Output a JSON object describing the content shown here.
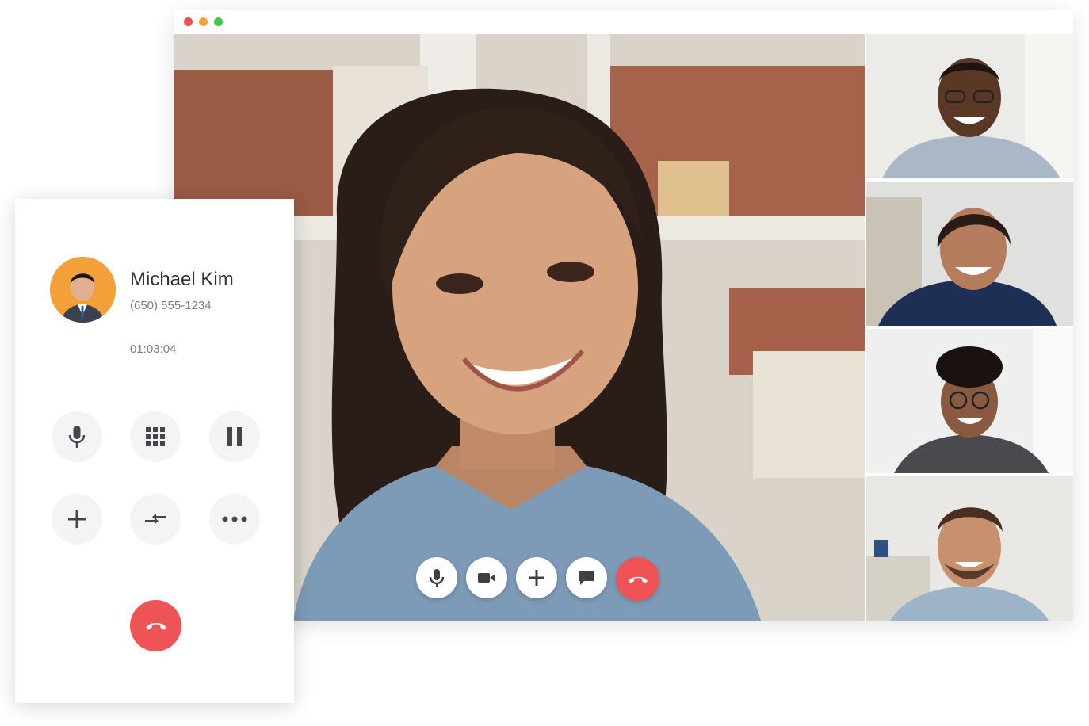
{
  "contact": {
    "name": "Michael Kim",
    "phone": "(650) 555-1234",
    "duration": "01:03:04"
  },
  "phone_controls": [
    {
      "id": "mute",
      "icon": "microphone-icon"
    },
    {
      "id": "keypad",
      "icon": "keypad-icon"
    },
    {
      "id": "hold",
      "icon": "pause-icon"
    },
    {
      "id": "add-call",
      "icon": "plus-icon"
    },
    {
      "id": "merge",
      "icon": "merge-arrows-icon"
    },
    {
      "id": "more",
      "icon": "more-dots-icon"
    },
    {
      "id": "hang-up",
      "icon": "hang-up-icon"
    }
  ],
  "video_controls": [
    {
      "id": "mic",
      "icon": "microphone-icon"
    },
    {
      "id": "camera",
      "icon": "video-camera-icon"
    },
    {
      "id": "add",
      "icon": "plus-icon"
    },
    {
      "id": "chat",
      "icon": "chat-bubble-icon"
    },
    {
      "id": "end-call",
      "icon": "hang-up-icon"
    }
  ],
  "window_controls": [
    "close",
    "minimize",
    "maximize"
  ],
  "colors": {
    "end_call": "#ef5356",
    "avatar_bg": "#f3a038",
    "window_close": "#ef4f52",
    "window_minimize": "#f4a53a",
    "window_maximize": "#3ec94b"
  }
}
